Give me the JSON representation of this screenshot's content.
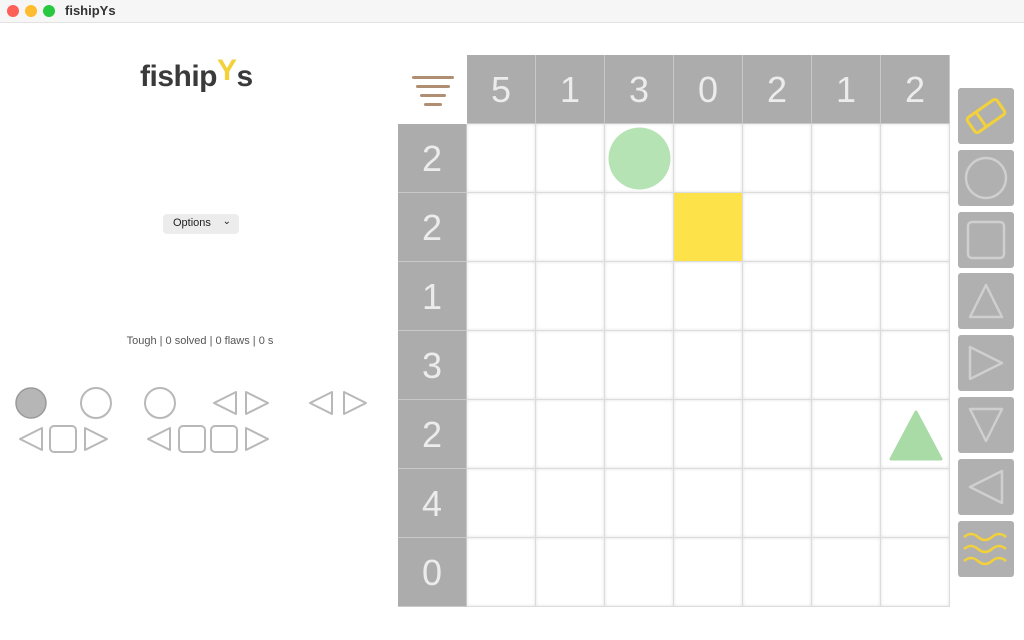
{
  "window": {
    "title": "fishipYs"
  },
  "logo": {
    "text_main": "fiship",
    "text_y": "Y",
    "text_end": "s"
  },
  "options": {
    "label": "Options"
  },
  "status": {
    "text": "Tough | 0 solved | 0 flaws | 0 s"
  },
  "column_clues": [
    "5",
    "1",
    "3",
    "0",
    "2",
    "1",
    "2"
  ],
  "row_clues": [
    "2",
    "2",
    "1",
    "3",
    "2",
    "4",
    "0"
  ],
  "placed": [
    {
      "row": 0,
      "col": 2,
      "shape": "circle",
      "color": "#b5e3b3"
    },
    {
      "row": 1,
      "col": 3,
      "shape": "square",
      "color": "#fde24a"
    },
    {
      "row": 4,
      "col": 6,
      "shape": "triangle-up",
      "color": "#a8dba6"
    }
  ],
  "toolbar": [
    "eraser-icon",
    "circle-icon",
    "square-icon",
    "triangle-up-icon",
    "triangle-right-icon",
    "triangle-down-icon",
    "triangle-left-icon",
    "water-icon"
  ],
  "colors": {
    "accent_yellow": "#f2d13b",
    "header_gray": "#acacac",
    "menu_brown": "#b08e72"
  }
}
